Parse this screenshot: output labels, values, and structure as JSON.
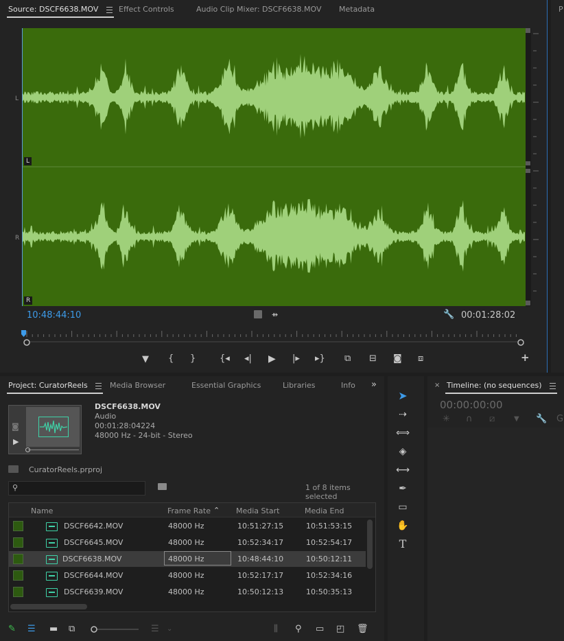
{
  "source_panel": {
    "tabs": [
      {
        "label": "Source: DSCF6638.MOV",
        "active": true
      },
      {
        "label": "Effect Controls"
      },
      {
        "label": "Audio Clip Mixer: DSCF6638.MOV"
      },
      {
        "label": "Metadata"
      }
    ],
    "channel_left": "L",
    "channel_right": "R",
    "timecode_current": "10:48:44:10",
    "timecode_duration": "00:01:28:02",
    "waveform_color": "#3a6b0c",
    "waveform_stroke": "#9fd07a",
    "transport": {
      "add_marker": "add-marker-icon",
      "mark_in": "mark-in-icon",
      "mark_out": "mark-out-icon",
      "go_to_in": "go-to-in-icon",
      "step_back": "step-back-icon",
      "play": "play-icon",
      "step_forward": "step-forward-icon",
      "go_to_out": "go-to-out-icon",
      "insert": "insert-icon",
      "overwrite": "overwrite-icon",
      "export_frame": "camera-icon",
      "settings": "button-editor-icon",
      "add": "plus-icon"
    }
  },
  "project_panel": {
    "tabs": [
      {
        "label": "Project: CuratorReels",
        "active": true
      },
      {
        "label": "Media Browser"
      },
      {
        "label": "Essential Graphics"
      },
      {
        "label": "Libraries"
      },
      {
        "label": "Info"
      }
    ],
    "preview": {
      "name": "DSCF6638.MOV",
      "type": "Audio",
      "duration": "00:01:28:04224",
      "format": "48000 Hz - 24-bit - Stereo"
    },
    "project_file": "CuratorReels.prproj",
    "search_placeholder": "",
    "selection_status": "1 of 8 items selected",
    "columns": {
      "name": "Name",
      "frame_rate": "Frame Rate",
      "media_start": "Media Start",
      "media_end": "Media End"
    },
    "rows": [
      {
        "name": "DSCF6642.MOV",
        "frame_rate": "48000 Hz",
        "media_start": "10:51:27:15",
        "media_end": "10:51:53:15",
        "selected": false
      },
      {
        "name": "DSCF6645.MOV",
        "frame_rate": "48000 Hz",
        "media_start": "10:52:34:17",
        "media_end": "10:52:54:17",
        "selected": false
      },
      {
        "name": "DSCF6638.MOV",
        "frame_rate": "48000 Hz",
        "media_start": "10:48:44:10",
        "media_end": "10:50:12:11",
        "selected": true
      },
      {
        "name": "DSCF6644.MOV",
        "frame_rate": "48000 Hz",
        "media_start": "10:52:17:17",
        "media_end": "10:52:34:16",
        "selected": false
      },
      {
        "name": "DSCF6639.MOV",
        "frame_rate": "48000 Hz",
        "media_start": "10:50:12:13",
        "media_end": "10:50:35:13",
        "selected": false
      }
    ],
    "label_color": "#2d5a10"
  },
  "timeline_panel": {
    "title": "Timeline: (no sequences)",
    "timecode": "00:00:00:00"
  },
  "tools": [
    "selection-tool-icon",
    "track-select-tool-icon",
    "ripple-edit-tool-icon",
    "razor-tool-icon",
    "slip-tool-icon",
    "pen-tool-icon",
    "rectangle-tool-icon",
    "hand-tool-icon",
    "type-tool-icon"
  ]
}
